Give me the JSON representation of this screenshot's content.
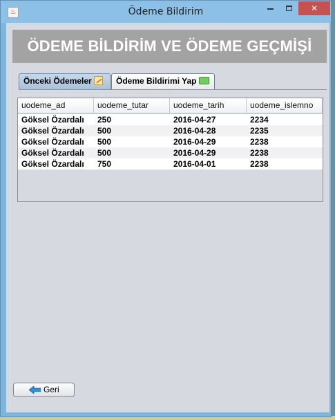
{
  "window": {
    "title": "Ödeme Bildirim",
    "close_symbol": "✕"
  },
  "header": {
    "title": "ÖDEME BİLDİRİM VE ÖDEME GEÇMİŞİ"
  },
  "tabs": [
    {
      "label": "Önceki Ödemeler",
      "icon": "note-icon",
      "selected": true
    },
    {
      "label": "Ödeme Bildirimi Yap",
      "icon": "money-icon",
      "selected": false
    }
  ],
  "table": {
    "columns": [
      "uodeme_ad",
      "uodeme_tutar",
      "uodeme_tarih",
      "uodeme_islemno"
    ],
    "rows": [
      [
        "Göksel Özardalı",
        "250",
        "2016-04-27",
        "2234"
      ],
      [
        "Göksel Özardalı",
        "500",
        "2016-04-28",
        "2235"
      ],
      [
        "Göksel Özardalı",
        "500",
        "2016-04-29",
        "2238"
      ],
      [
        "Göksel Özardalı",
        "500",
        "2016-04-29",
        "2238"
      ],
      [
        "Göksel Özardalı",
        "750",
        "2016-04-01",
        "2238"
      ]
    ]
  },
  "footer": {
    "back_label": "Geri",
    "back_icon": "left-arrow-icon"
  },
  "colors": {
    "header_bg": "#a3a3a3",
    "client_bg": "#d6d9df",
    "close_button": "#c75050"
  }
}
